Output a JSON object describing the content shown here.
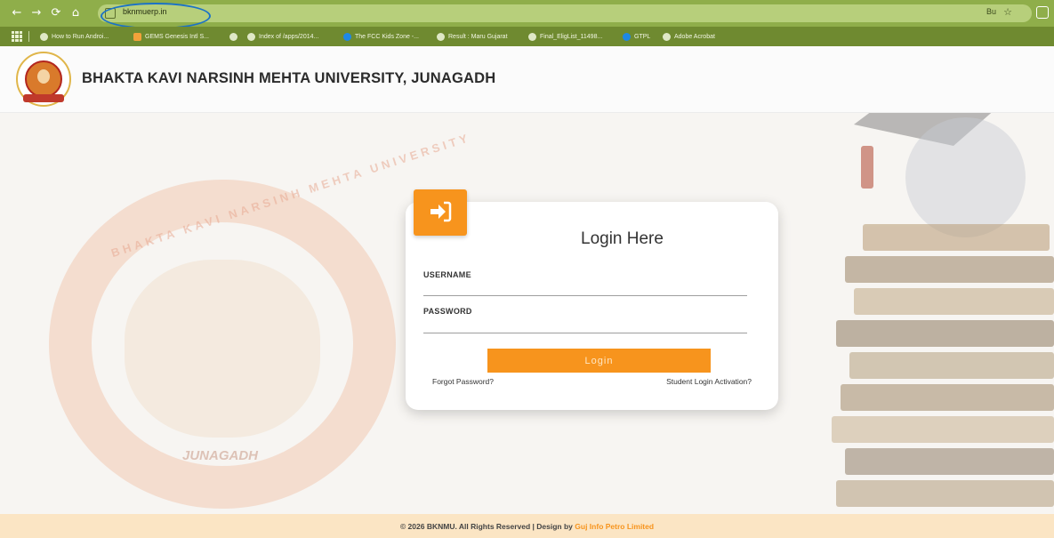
{
  "browser": {
    "url": "bknmuerp.in",
    "right_text": "Bu",
    "bookmarks": [
      {
        "label": "How to Run Androi...",
        "icon": "globe-icon"
      },
      {
        "label": "GEMS Genesis Intl S...",
        "icon": "orange-square-icon"
      },
      {
        "label": "",
        "icon": "globe-icon"
      },
      {
        "label": "Index of /apps/2014...",
        "icon": "globe-icon"
      },
      {
        "label": "The FCC Kids Zone -...",
        "icon": "blue-figure-icon"
      },
      {
        "label": "Result : Maru Gujarat",
        "icon": "globe-icon"
      },
      {
        "label": "Final_EligList_11498...",
        "icon": "globe-icon"
      },
      {
        "label": "GTPL",
        "icon": "blue-circle-icon"
      },
      {
        "label": "Adobe Acrobat",
        "icon": "globe-icon"
      }
    ]
  },
  "header": {
    "title": "BHAKTA KAVI NARSINH MEHTA UNIVERSITY, JUNAGADH"
  },
  "watermark": {
    "arc_text": "BHAKTA KAVI NARSINH MEHTA UNIVERSITY",
    "city": "JUNAGADH"
  },
  "login": {
    "title": "Login Here",
    "username_label": "USERNAME",
    "username_value": "",
    "password_label": "PASSWORD",
    "password_value": "",
    "button_label": "Login",
    "forgot_link": "Forgot Password?",
    "activation_link": "Student Login Activation?"
  },
  "footer": {
    "text": "© 2026 BKNMU. All Rights Reserved | Design by",
    "brand": "Guj Info Petro Limited"
  },
  "colors": {
    "accent": "#f7941d",
    "toolbar": "#8fae4a",
    "bookmarks_bar": "#6f8a30",
    "footer_bg": "#fbe5c4"
  }
}
